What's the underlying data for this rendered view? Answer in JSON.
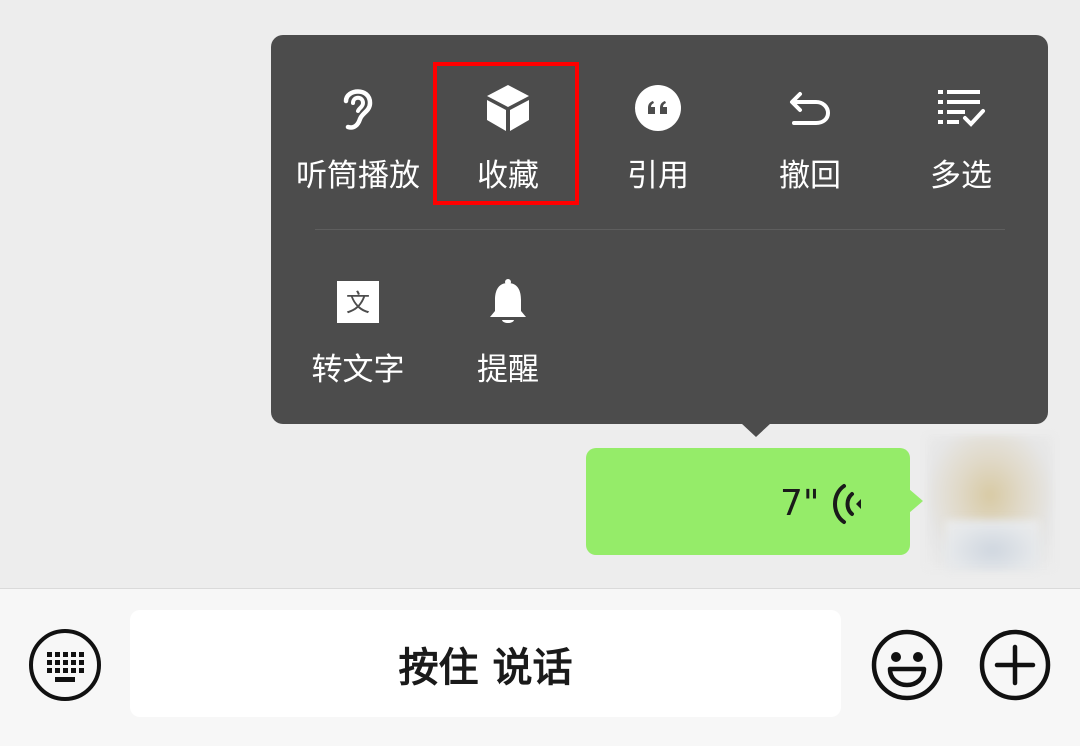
{
  "menu": {
    "row1": [
      {
        "label": "听筒播放",
        "icon": "ear-icon"
      },
      {
        "label": "收藏",
        "icon": "cube-icon"
      },
      {
        "label": "引用",
        "icon": "quote-icon"
      },
      {
        "label": "撤回",
        "icon": "undo-icon"
      },
      {
        "label": "多选",
        "icon": "multi-select-icon"
      }
    ],
    "row2": [
      {
        "label": "转文字",
        "icon": "translate-text-icon"
      },
      {
        "label": "提醒",
        "icon": "bell-icon"
      }
    ]
  },
  "message": {
    "duration": "7\"",
    "bubble_color": "#95ec69"
  },
  "input_bar": {
    "talk_label": "按住 说话"
  },
  "colors": {
    "menu_bg": "#4c4c4c",
    "highlight": "#ff0000",
    "chat_bg": "#ededed"
  }
}
